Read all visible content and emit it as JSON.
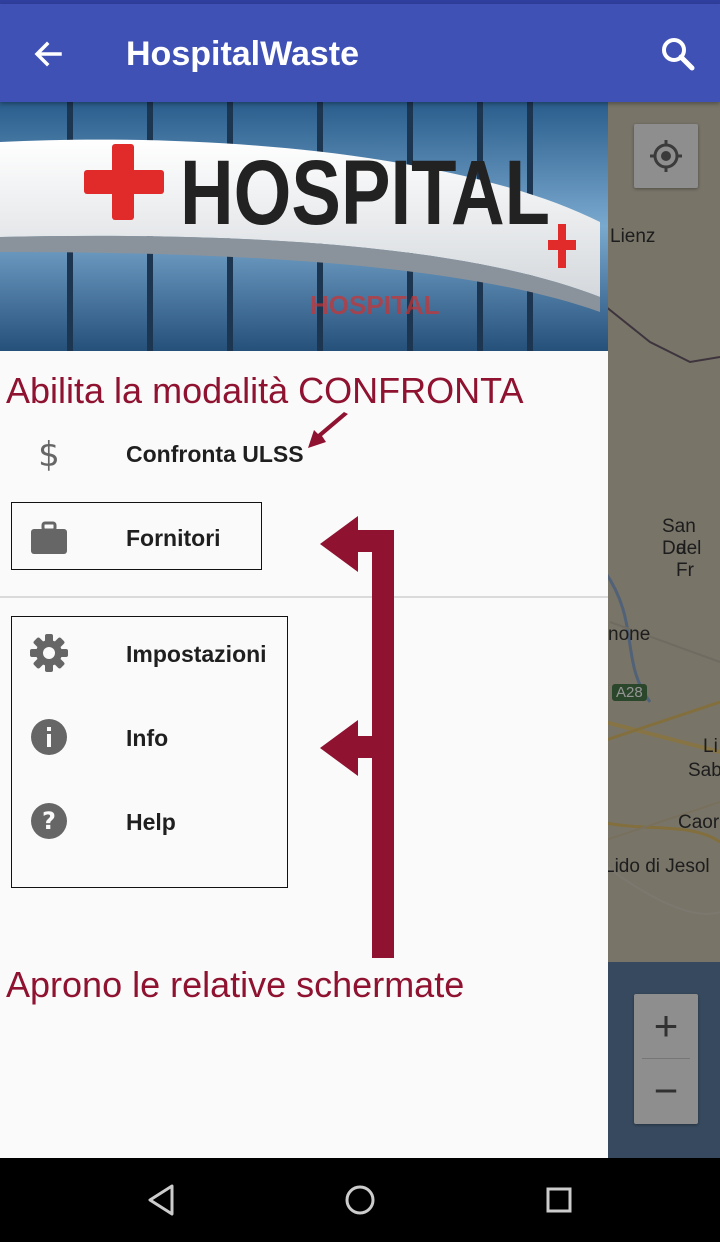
{
  "app_bar": {
    "title": "HospitalWaste"
  },
  "header": {
    "sign_text": "HOSPITAL",
    "reflection_text": "HOSPITAL"
  },
  "menu": {
    "compare": {
      "label": "Confronta ULSS",
      "icon": "dollar-icon"
    },
    "suppliers": {
      "label": "Fornitori",
      "icon": "briefcase-icon"
    },
    "settings": {
      "label": "Impostazioni",
      "icon": "gear-icon"
    },
    "info": {
      "label": "Info",
      "icon": "info-icon"
    },
    "help": {
      "label": "Help",
      "icon": "help-icon"
    }
  },
  "annotations": {
    "top": "Abilita la modalità CONFRONTA",
    "bottom": "Aprono le relative schermate"
  },
  "map": {
    "labels": [
      "Lienz",
      "San Da",
      "del Fr",
      "none",
      "A28",
      "Li",
      "Sab",
      "Caorl",
      "Lido di Jesol"
    ],
    "zoom_in": "+",
    "zoom_out": "−"
  },
  "colors": {
    "primary": "#3f51b5",
    "annotation": "#8f1230",
    "cross": "#e12a2a"
  }
}
